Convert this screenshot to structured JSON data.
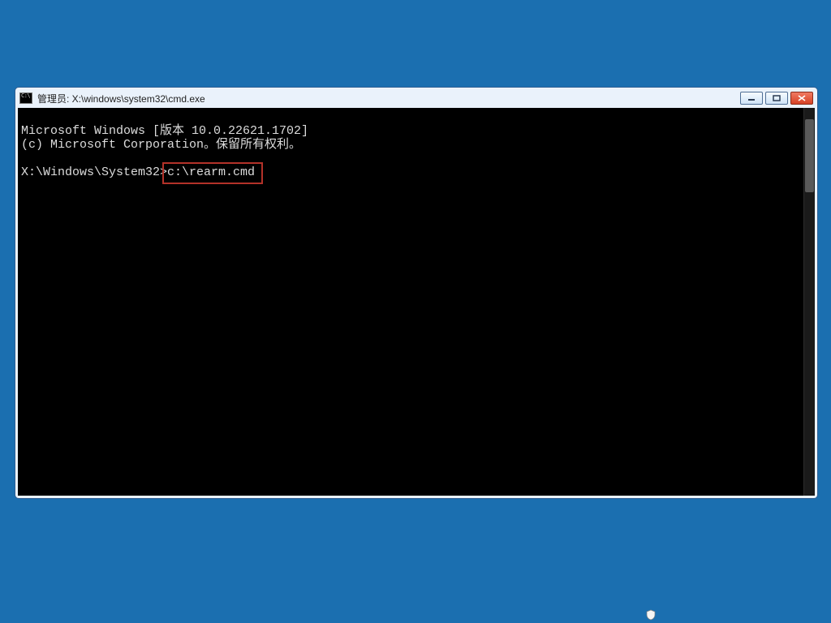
{
  "window": {
    "title": "管理员: X:\\windows\\system32\\cmd.exe"
  },
  "terminal": {
    "line1": "Microsoft Windows [版本 10.0.22621.1702]",
    "line2": "(c) Microsoft Corporation。保留所有权利。",
    "blank": "",
    "prompt": "X:\\Windows\\System32>",
    "command": "c:\\rearm.cmd"
  },
  "icons": {
    "app": "cmd-icon",
    "minimize": "minimize-icon",
    "maximize": "maximize-icon",
    "close": "close-icon",
    "tray": "shield-icon"
  },
  "colors": {
    "desktop": "#1b6fb0",
    "terminal_bg": "#000000",
    "terminal_fg": "#dcdcdc",
    "highlight": "#b33229",
    "close_btn": "#d64225"
  }
}
